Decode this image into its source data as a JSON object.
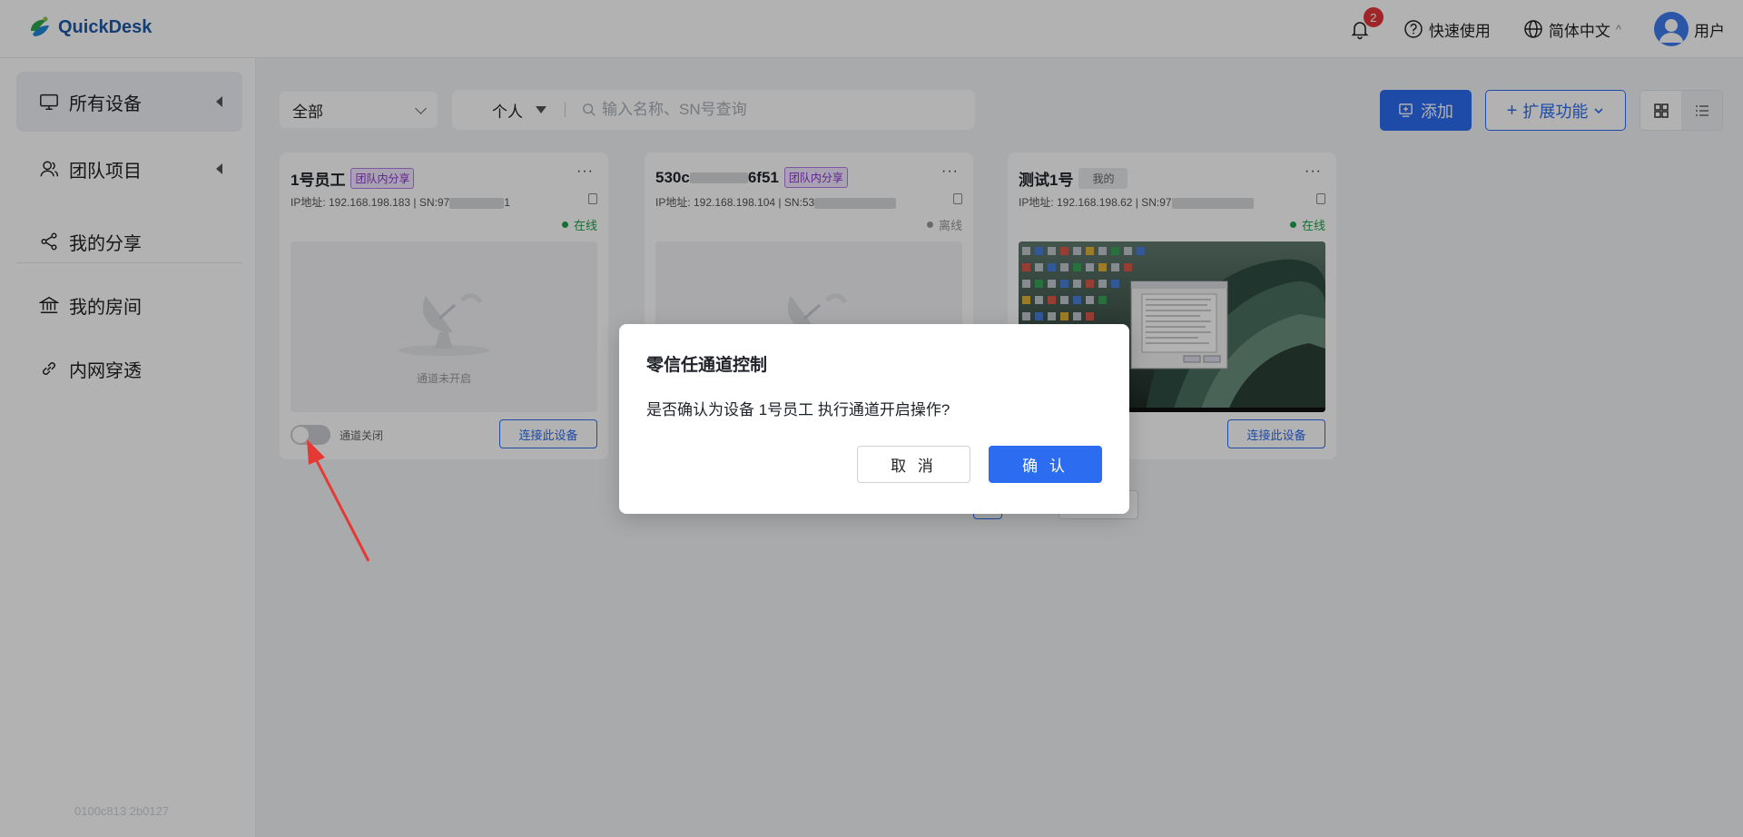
{
  "header": {
    "app_name": "QuickDesk",
    "notification_count": "2",
    "quick_start": "快速使用",
    "language": "简体中文",
    "language_caret": "^",
    "user": "用户"
  },
  "sidebar": {
    "items": [
      {
        "label": "所有设备",
        "icon": "monitor-icon",
        "expandable": true
      },
      {
        "label": "团队项目",
        "icon": "team-icon",
        "expandable": true
      },
      {
        "label": "我的分享",
        "icon": "share-icon"
      },
      {
        "label": "我的房间",
        "icon": "bank-icon"
      },
      {
        "label": "内网穿透",
        "icon": "link-icon"
      }
    ],
    "version": "0100c813 2b0127"
  },
  "toolbar": {
    "filter_selected": "全部",
    "scope_selected": "个人",
    "search_placeholder": "输入名称、SN号查询",
    "add_label": "添加",
    "extend_label": "扩展功能"
  },
  "devices": [
    {
      "name": "1号员工",
      "tag": "团队内分享",
      "ip_prefix": "IP地址: 192.168.198.183 | SN:97",
      "sn_suffix": "1",
      "status": "在线",
      "thumb_label": "通道未开启",
      "toggle_label": "通道关闭",
      "connect_label": "连接此设备"
    },
    {
      "name_prefix": "530c",
      "name_suffix": "6f51",
      "tag": "团队内分享",
      "ip_prefix": "IP地址: 192.168.198.104 | SN:53",
      "status": "离线"
    },
    {
      "name": "测试1号",
      "tag": "我的",
      "ip_prefix": "IP地址: 192.168.198.62 | SN:97",
      "status": "在线",
      "connect_label": "连接此设备"
    }
  ],
  "dialog": {
    "title": "零信任通道控制",
    "message": "是否确认为设备 1号员工 执行通道开启操作?",
    "cancel": "取 消",
    "confirm": "确 认"
  },
  "colors": {
    "primary": "#2c6cf0",
    "online": "#1aa34a",
    "team_tag": "#8a2fd2",
    "annotation_arrow": "#e53935"
  }
}
